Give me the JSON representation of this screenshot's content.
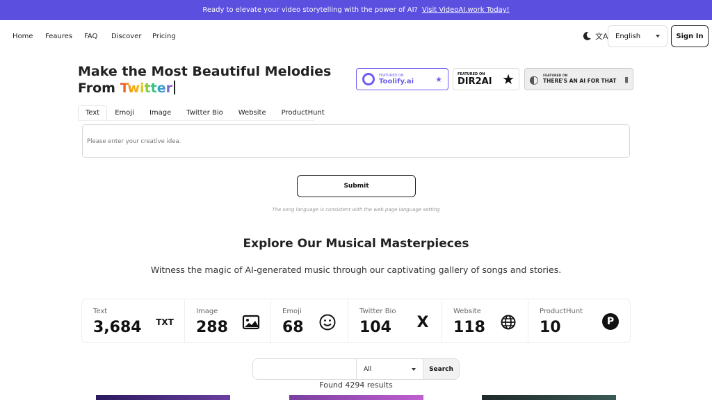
{
  "banner": {
    "text": "Ready to elevate your video storytelling with the power of AI?",
    "link": "Visit VideoAI.work Today!"
  },
  "nav": {
    "links": [
      "Home",
      "Feaures",
      "FAQ",
      "Discover",
      "Pricing"
    ],
    "language": "English",
    "sign_in": "Sign In"
  },
  "hero": {
    "title_line1": "Make the Most Beautiful Melodies",
    "title_prefix": "From ",
    "title_highlight": "Twitter"
  },
  "badges": {
    "toolify": {
      "small": "FEATURED ON",
      "big": "Toolify.ai"
    },
    "dir2ai": {
      "small": "FEATURED ON",
      "big": "DIR2AI"
    },
    "aift": {
      "small": "FEATURED ON",
      "big": "THERE'S AN AI FOR THAT"
    }
  },
  "tabs": [
    "Text",
    "Emoji",
    "Image",
    "Twitter Bio",
    "Website",
    "ProductHunt"
  ],
  "idea": {
    "placeholder": "Please enter your creative idea."
  },
  "submit": "Submit",
  "note": "The song language is consistent with the web page language setting",
  "explore": {
    "title": "Explore Our Musical Masterpieces",
    "subtitle": "Witness the magic of AI-generated music through our captivating gallery of songs and stories."
  },
  "stats": [
    {
      "label": "Text",
      "value": "3,684",
      "icon": "txt-icon",
      "glyph": "TXT"
    },
    {
      "label": "Image",
      "value": "288",
      "icon": "image-icon",
      "glyph": ""
    },
    {
      "label": "Emoji",
      "value": "68",
      "icon": "smiley-icon",
      "glyph": ""
    },
    {
      "label": "Twitter Bio",
      "value": "104",
      "icon": "x-logo-icon",
      "glyph": "X"
    },
    {
      "label": "Website",
      "value": "118",
      "icon": "globe-icon",
      "glyph": ""
    },
    {
      "label": "ProductHunt",
      "value": "10",
      "icon": "producthunt-icon",
      "glyph": "P"
    }
  ],
  "search": {
    "filter": "All",
    "button": "Search"
  },
  "results": "Found 4294 results",
  "colors": {
    "accent": "#5b4fe0",
    "toolify": "#6a5cf0"
  }
}
